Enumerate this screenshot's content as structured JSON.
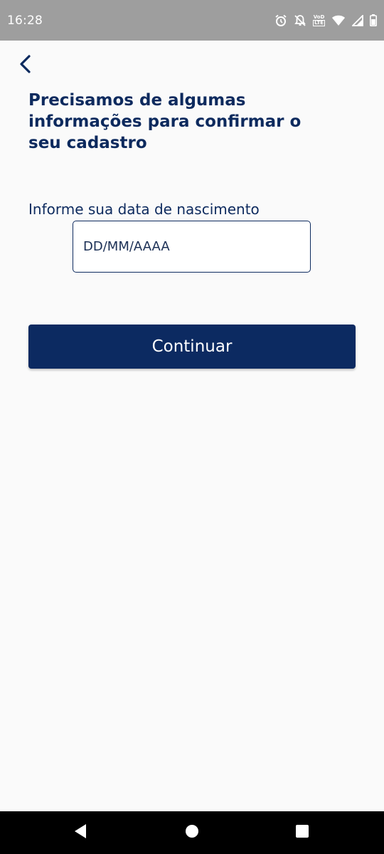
{
  "status_bar": {
    "time": "16:28",
    "icons": [
      "alarm-icon",
      "notifications-off-icon",
      "volte-icon",
      "wifi-icon",
      "cell-signal-icon",
      "battery-icon"
    ],
    "volte_top": "VoD",
    "volte_bottom": "LTE"
  },
  "header": {
    "back_icon": "chevron-left-icon"
  },
  "main": {
    "title": "Precisamos de algumas informações para confirmar o seu cadastro",
    "birthdate_label": "Informe sua data de nascimento",
    "birthdate_value": "",
    "birthdate_placeholder": "DD/MM/AAAA",
    "continue_label": "Continuar"
  },
  "nav_bar": {
    "icons": [
      "back-triangle-icon",
      "home-circle-icon",
      "recents-square-icon"
    ]
  },
  "colors": {
    "primary": "#0c2a61",
    "text": "#0d2a5e",
    "background": "#fafafa",
    "status_bar": "#9e9e9e",
    "nav_bar": "#000000"
  }
}
